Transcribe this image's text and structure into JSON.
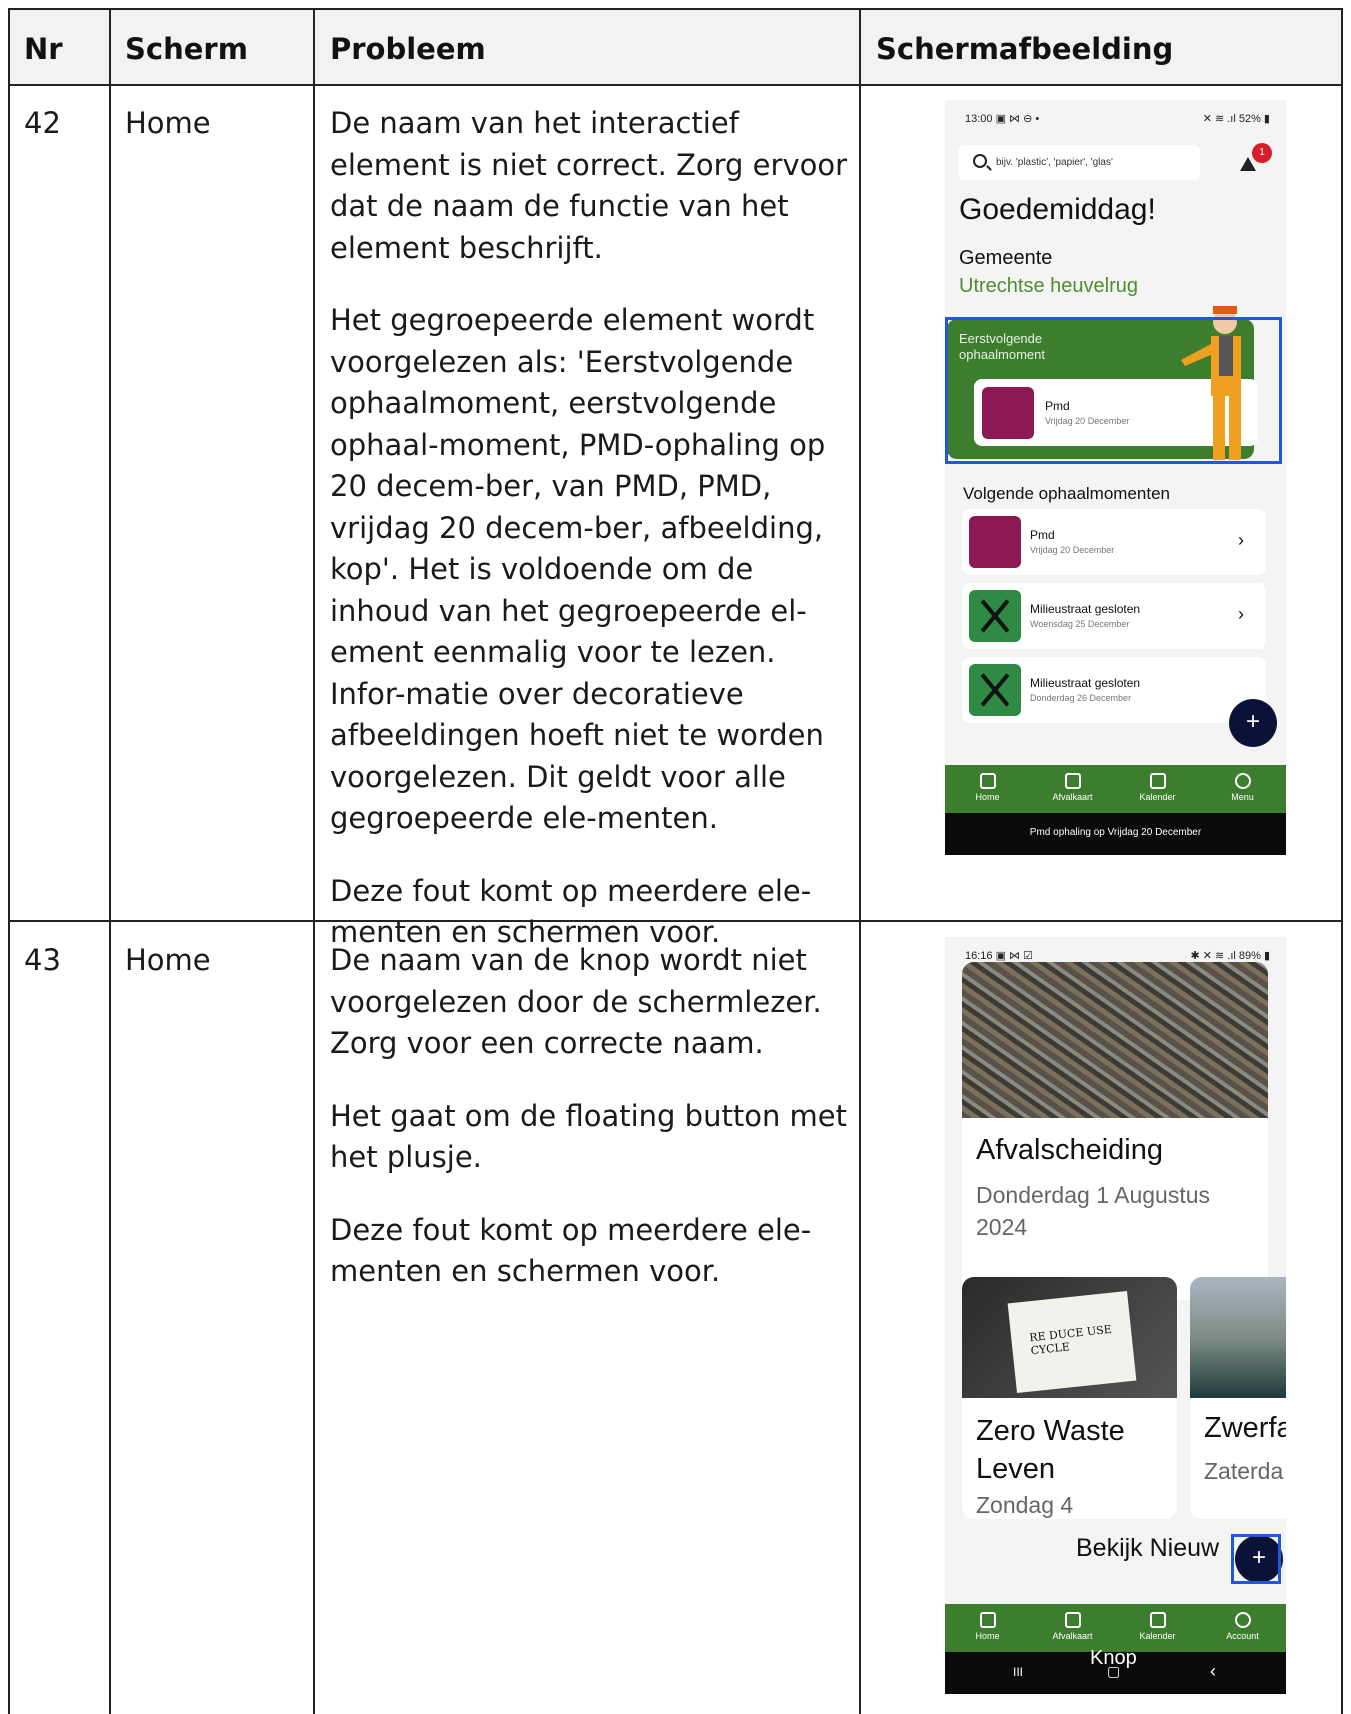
{
  "table": {
    "headers": [
      "Nr",
      "Scherm",
      "Probleem",
      "Schermafbeelding"
    ],
    "rows": [
      {
        "nr": "42",
        "scherm": "Home",
        "probleem": [
          "De naam van het interactief element is niet correct. Zorg ervoor dat de naam de functie van het element beschrijft.",
          "Het gegroepeerde element wordt voorgelezen als: 'Eerstvolgende ophaalmoment, eerstvolgende ophaal-moment, PMD-ophaling op 20 decem-ber, van PMD, PMD, vrijdag 20 decem-ber, afbeelding, kop'. Het is voldoende om de inhoud van het gegroepeerde el-ement eenmalig voor te lezen. Infor-matie over decoratieve afbeeldingen hoeft niet te worden voorgelezen. Dit geldt voor alle gegroepeerde ele-menten.",
          "Deze fout komt op meerdere ele-menten en schermen voor."
        ]
      },
      {
        "nr": "43",
        "scherm": "Home",
        "probleem": [
          "De naam van de knop wordt niet voorgelezen door de schermlezer. Zorg voor een correcte naam.",
          "Het gaat om de floating button met het plusje.",
          "Deze fout komt op meerdere ele-menten en schermen voor."
        ]
      }
    ]
  },
  "screenshot1": {
    "status_time": "13:00 ▣ ⋈ ⊖ •",
    "status_right": "✕ ≋ .ıl 52% ▮",
    "search_placeholder": "bijv. 'plastic', 'papier', 'glas'",
    "badge_count": "1",
    "greeting": "Goedemiddag!",
    "gemeente_label": "Gemeente",
    "gemeente_name": "Utrechtse heuvelrug",
    "hero_title": "Eerstvolgende ophaalmoment",
    "hero_item_name": "Pmd",
    "hero_item_date": "Vrijdag 20 December",
    "section_title": "Volgende ophaalmomenten",
    "items": [
      {
        "name": "Pmd",
        "date": "Vrijdag 20 December",
        "chevron": "›"
      },
      {
        "name": "Milieustraat gesloten",
        "date": "Woensdag 25 December",
        "chevron": "›"
      },
      {
        "name": "Milieustraat gesloten",
        "date": "Donderdag 26 December",
        "chevron": ""
      }
    ],
    "fab_label": "+",
    "tabs": [
      "Home",
      "Afvalkaart",
      "Kalender",
      "Menu"
    ],
    "caption": "Pmd ophaling op Vrijdag 20 December",
    "colors": {
      "green": "#3d7e2e",
      "pmd": "#8c1952",
      "focus": "#1e5ad6",
      "fab": "#0b1238"
    }
  },
  "screenshot2": {
    "status_time": "16:16 ▣ ⋈ ☑",
    "status_right": "✱ ✕ ≋ .ıl 89% ▮",
    "article1_title": "Afvalscheiding",
    "article1_date": "Donderdag 1 Augustus 2024",
    "article2_image_text": "RE DUCE USE CYCLE",
    "article2_title": "Zero Waste Leven",
    "article2_date": "Zondag 4",
    "article3_title": "Zwerfa",
    "article3_date": "Zaterda August",
    "bekijk": "Bekijk Nieuw",
    "fab_label": "+",
    "tabs": [
      "Home",
      "Afvalkaart",
      "Kalender",
      "Account"
    ],
    "caption": "Knop",
    "nav_buttons": [
      "III",
      "▢",
      "‹"
    ]
  }
}
